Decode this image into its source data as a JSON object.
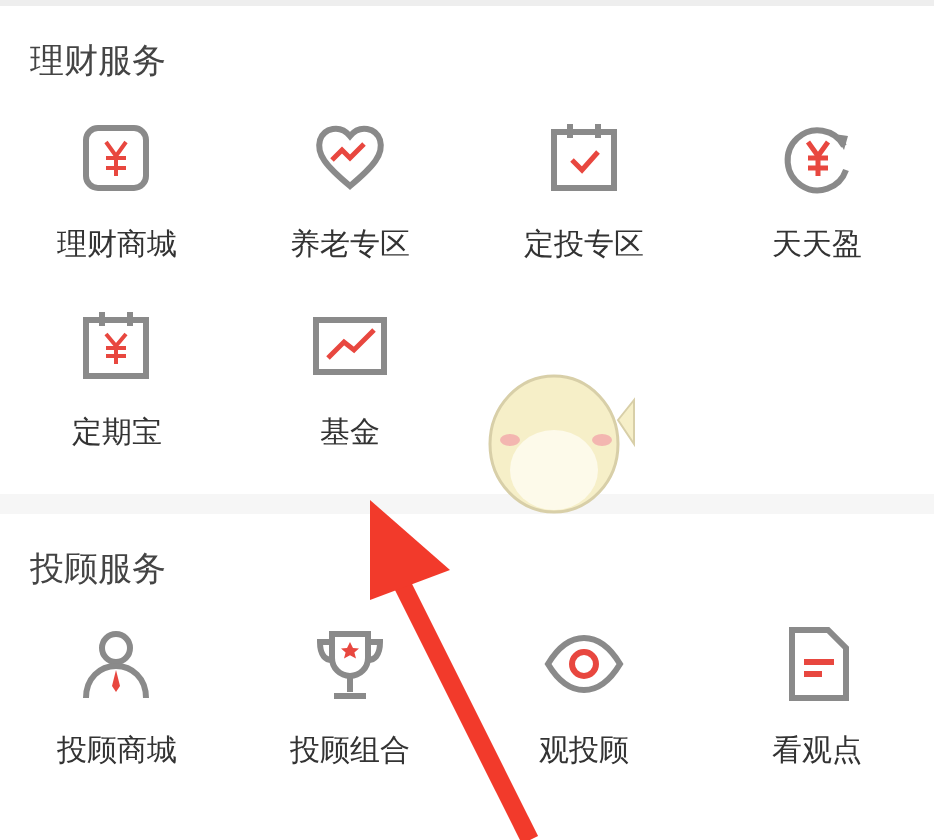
{
  "sections": [
    {
      "title": "理财服务",
      "items": [
        {
          "label": "理财商城"
        },
        {
          "label": "养老专区"
        },
        {
          "label": "定投专区"
        },
        {
          "label": "天天盈"
        },
        {
          "label": "定期宝"
        },
        {
          "label": "基金"
        }
      ]
    },
    {
      "title": "投顾服务",
      "items": [
        {
          "label": "投顾商城"
        },
        {
          "label": "投顾组合"
        },
        {
          "label": "观投顾"
        },
        {
          "label": "看观点"
        }
      ]
    }
  ]
}
